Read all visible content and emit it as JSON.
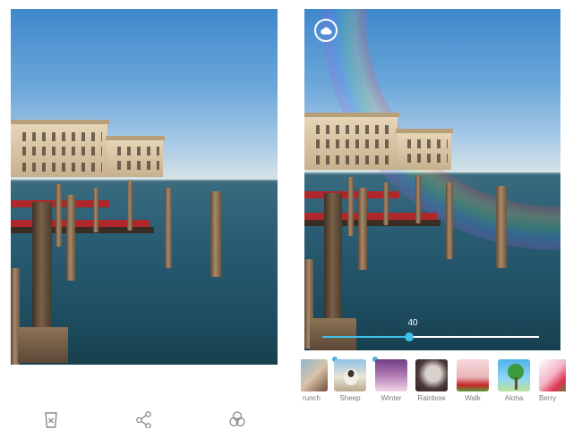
{
  "editor": {
    "filter_strength_label": "40",
    "filter_strength": 40,
    "filter_strength_max": 100,
    "cloud_icon": "cloud-icon"
  },
  "filters": [
    {
      "label": "runch",
      "downloadable": false
    },
    {
      "label": "Sheep",
      "downloadable": true
    },
    {
      "label": "Winter",
      "downloadable": true
    },
    {
      "label": "Rainbow",
      "downloadable": false
    },
    {
      "label": "Walk",
      "downloadable": false
    },
    {
      "label": "Aloha",
      "downloadable": false
    },
    {
      "label": "Berry",
      "downloadable": false
    }
  ],
  "bottom_bar": {
    "icons": [
      "trash-icon",
      "share-icon",
      "filters-icon"
    ]
  },
  "colors": {
    "accent": "#3ec0e6",
    "label": "#7a7a7a",
    "icon": "#8a8a8a"
  }
}
